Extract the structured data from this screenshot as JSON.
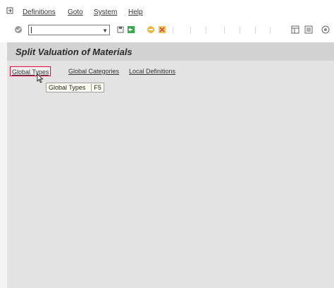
{
  "menu": {
    "items": [
      "Definitions",
      "Goto",
      "System",
      "Help"
    ]
  },
  "toolbar": {
    "command_value": "",
    "icons": [
      "check-icon",
      "save-icon",
      "back-icon",
      "exit-icon",
      "cancel-icon",
      "print-icon",
      "find-icon",
      "layout-icon",
      "help-icon"
    ]
  },
  "page": {
    "title": "Split Valuation of Materials"
  },
  "nav": {
    "global_types": "Global Types",
    "global_categories": "Global Categories",
    "local_definitions": "Local Definitions"
  },
  "tooltip": {
    "label": "Global Types",
    "key": "F5"
  },
  "colors": {
    "active_outline": "#d21e4c",
    "content_bg": "#e3e3e3",
    "title_bg": "#d2d2d2"
  }
}
